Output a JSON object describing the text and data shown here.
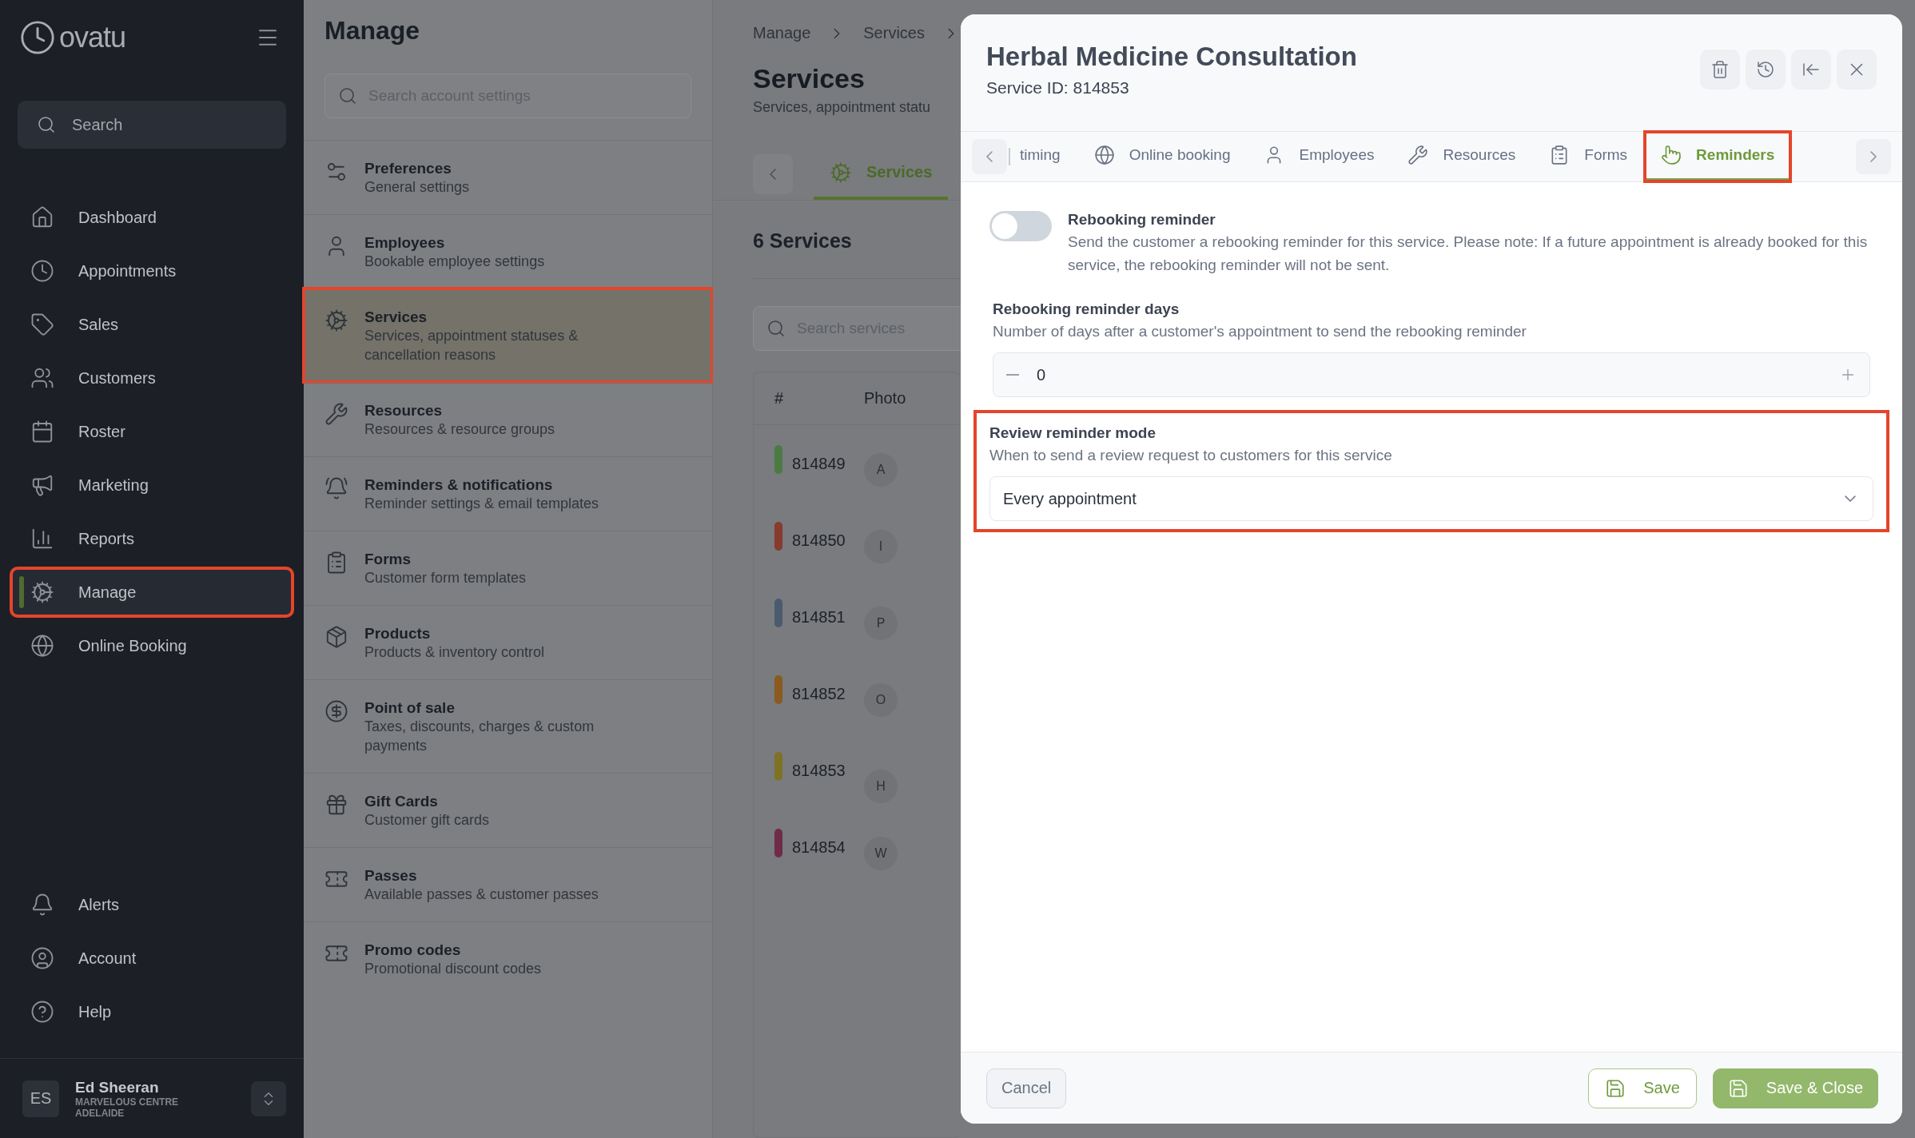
{
  "sidebar": {
    "logo": "ovatu",
    "search": {
      "placeholder": "Search"
    },
    "nav": [
      {
        "label": "Dashboard",
        "selected": false,
        "highlighted": false
      },
      {
        "label": "Appointments",
        "selected": false,
        "highlighted": false
      },
      {
        "label": "Sales",
        "selected": false,
        "highlighted": false
      },
      {
        "label": "Customers",
        "selected": false,
        "highlighted": false
      },
      {
        "label": "Roster",
        "selected": false,
        "highlighted": false
      },
      {
        "label": "Marketing",
        "selected": false,
        "highlighted": false
      },
      {
        "label": "Reports",
        "selected": false,
        "highlighted": false
      },
      {
        "label": "Manage",
        "selected": true,
        "highlighted": true
      },
      {
        "label": "Online Booking",
        "selected": false,
        "highlighted": false
      }
    ],
    "bottom_nav": [
      {
        "label": "Alerts"
      },
      {
        "label": "Account"
      },
      {
        "label": "Help"
      }
    ],
    "user": {
      "initials": "ES",
      "name": "Ed Sheeran",
      "location": "MARVELOUS CENTRE ADELAIDE"
    }
  },
  "manage_panel": {
    "title": "Manage",
    "search": {
      "placeholder": "Search account settings"
    },
    "items": [
      {
        "title": "Preferences",
        "subtitle": "General settings",
        "selected": false,
        "highlighted": false
      },
      {
        "title": "Employees",
        "subtitle": "Bookable employee settings",
        "selected": false,
        "highlighted": false
      },
      {
        "title": "Services",
        "subtitle": "Services, appointment statuses & cancellation reasons",
        "selected": true,
        "highlighted": true
      },
      {
        "title": "Resources",
        "subtitle": "Resources & resource groups",
        "selected": false,
        "highlighted": false
      },
      {
        "title": "Reminders & notifications",
        "subtitle": "Reminder settings & email templates",
        "selected": false,
        "highlighted": false
      },
      {
        "title": "Forms",
        "subtitle": "Customer form templates",
        "selected": false,
        "highlighted": false
      },
      {
        "title": "Products",
        "subtitle": "Products & inventory control",
        "selected": false,
        "highlighted": false
      },
      {
        "title": "Point of sale",
        "subtitle": "Taxes, discounts, charges & custom payments",
        "selected": false,
        "highlighted": false
      },
      {
        "title": "Gift Cards",
        "subtitle": "Customer gift cards",
        "selected": false,
        "highlighted": false
      },
      {
        "title": "Passes",
        "subtitle": "Available passes & customer passes",
        "selected": false,
        "highlighted": false
      },
      {
        "title": "Promo codes",
        "subtitle": "Promotional discount codes",
        "selected": false,
        "highlighted": false
      }
    ]
  },
  "services_page": {
    "breadcrumb": [
      "Manage",
      "Services"
    ],
    "title": "Services",
    "subtitle": "Services, appointment statu",
    "tabs": [
      {
        "label": "Services",
        "selected": true
      }
    ],
    "count": "6 Services",
    "search": {
      "placeholder": "Search services"
    },
    "table": {
      "columns": [
        "#",
        "Photo"
      ],
      "rows": [
        {
          "id": "814849",
          "color": "#4c7a43",
          "photo": "A"
        },
        {
          "id": "814850",
          "color": "#873a2e",
          "photo": "I"
        },
        {
          "id": "814851",
          "color": "#4c5a70",
          "photo": "P"
        },
        {
          "id": "814852",
          "color": "#8a5a1f",
          "photo": "O"
        },
        {
          "id": "814853",
          "color": "#7e7224",
          "photo": "H"
        },
        {
          "id": "814854",
          "color": "#6e2c48",
          "photo": "W"
        }
      ]
    }
  },
  "modal": {
    "title": "Herbal Medicine Consultation",
    "service_id": "Service ID: 814853",
    "tabs": [
      {
        "label": "timing",
        "selected": false,
        "highlighted": false
      },
      {
        "label": "Online booking",
        "selected": false,
        "highlighted": false
      },
      {
        "label": "Employees",
        "selected": false,
        "highlighted": false
      },
      {
        "label": "Resources",
        "selected": false,
        "highlighted": false
      },
      {
        "label": "Forms",
        "selected": false,
        "highlighted": false
      },
      {
        "label": "Reminders",
        "selected": true,
        "highlighted": true
      }
    ],
    "rebooking": {
      "on": false,
      "label": "Rebooking reminder",
      "description": "Send the customer a rebooking reminder for this service. Please note: If a future appointment is already booked for this service, the rebooking reminder will not be sent."
    },
    "days": {
      "label": "Rebooking reminder days",
      "description": "Number of days after a customer's appointment to send the rebooking reminder",
      "value": "0"
    },
    "review": {
      "label": "Review reminder mode",
      "description": "When to send a review request to customers for this service",
      "value": "Every appointment",
      "highlighted": true
    },
    "buttons": {
      "cancel": "Cancel",
      "save": "Save",
      "save_close": "Save & Close"
    }
  }
}
